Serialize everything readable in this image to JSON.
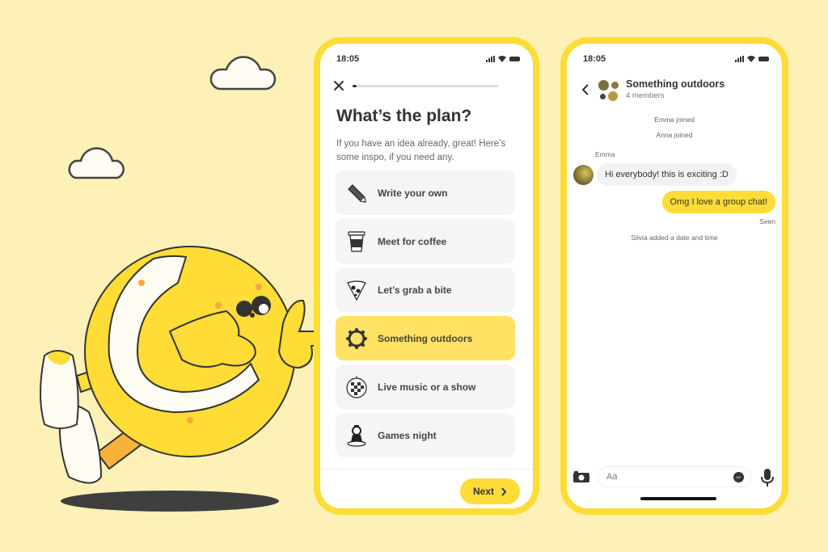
{
  "colors": {
    "background": "#fdf1b8",
    "accent": "#ffdc36",
    "selected_option": "#ffe164",
    "option_bg": "#f5f5f5",
    "text_dark": "#333333"
  },
  "illustration": {
    "clouds": [
      "cloud",
      "cloud"
    ],
    "mascot": "yellow tennis-ball character pointing right",
    "shadow": "ground-shadow"
  },
  "phone_plan": {
    "status_bar": {
      "time": "18:05",
      "icons": [
        "signal-icon",
        "wifi-icon",
        "battery-icon"
      ]
    },
    "close_icon": "close-icon",
    "progress_fraction": 0.03,
    "title": "What’s the plan?",
    "subtitle": "If you have an idea already, great! Here’s some inspo, if you need any.",
    "options": [
      {
        "label": "Write your own",
        "icon": "pencil-icon",
        "selected": false
      },
      {
        "label": "Meet for coffee",
        "icon": "coffee-cup-icon",
        "selected": false
      },
      {
        "label": "Let’s grab a bite",
        "icon": "pizza-slice-icon",
        "selected": false
      },
      {
        "label": "Something outdoors",
        "icon": "sun-icon",
        "selected": true
      },
      {
        "label": "Live music or a show",
        "icon": "disco-ball-icon",
        "selected": false
      },
      {
        "label": "Games night",
        "icon": "chess-pawn-icon",
        "selected": false
      }
    ],
    "next_label": "Next"
  },
  "phone_chat": {
    "status_bar": {
      "time": "18:05",
      "icons": [
        "signal-icon",
        "wifi-icon",
        "battery-icon"
      ]
    },
    "header": {
      "title": "Something outdoors",
      "subtitle": "4 members"
    },
    "system_messages": [
      "Emma joined",
      "Anna joined"
    ],
    "messages": [
      {
        "sender": "Emma",
        "text": "Hi everybody! this is exciting :D",
        "direction": "incoming"
      },
      {
        "sender": "me",
        "text": "Omg I love a group chat!",
        "direction": "outgoing",
        "status": "Seen"
      }
    ],
    "event_message": "Silvia added a date and time",
    "composer": {
      "placeholder": "Aa",
      "gif_label": "GIF"
    }
  }
}
